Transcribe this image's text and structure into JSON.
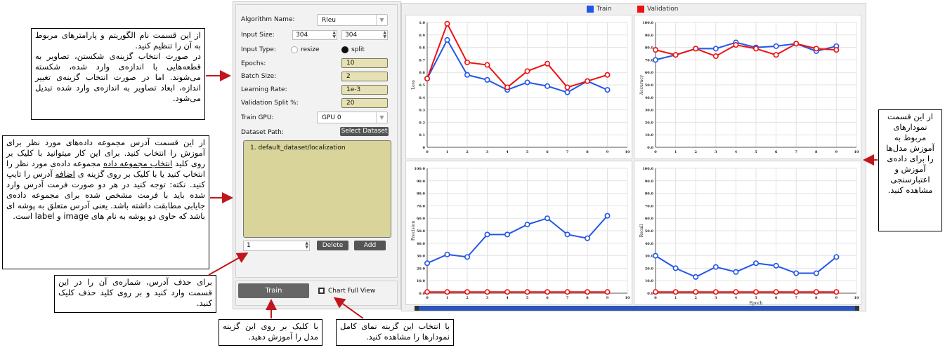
{
  "callouts": {
    "params": [
      "از این قسمت نام الگوریتم و پارامترهای مربوط به آن را تنظیم کنید.",
      "در صورت انتخاب گزینه‌ی شکستن، تصاویر به قطعه‌هایی با اندازه‌ی وارد شده، شکسته می‌شوند. اما در صورت انتخاب گزینه‌ی تغییر اندازه، ابعاد تصاویر به اندازه‌ی وارد شده تبدیل می‌شود."
    ],
    "dataset_a": "از این قسمت آدرس مجموعه داده‌های مورد نظر برای آموزش را انتخاب کنید. برای این کار میتوانید با کلیک بر روی کلید",
    "dataset_u1": "انتخاب مجموعه داده",
    "dataset_b": "مجموعه داده‌ی مورد نظر را انتخاب کنید یا با کلیک بر روی گزینه ی",
    "dataset_u2": "اضافه",
    "dataset_c": "آدرس را تایپ کنید. نکته: توجه کنید در هر دو صورت فرمت آدرس وارد شده باید با فرمت مشخص شده برای مجموعه داده‌ی جایابی مطابقت داشته باشد. یعنی آدرس متعلق به پوشه ای باشد که حاوی دو پوشه به نام های image و label است.",
    "delete": "برای حذف آدرس، شماره‌ی آن را در این قسمت وارد کنید و بر روی کلید حذف کلیک کنید.",
    "train": "با کلیک بر روی این گزینه مدل را آموزش دهید.",
    "fullview": "با انتخاب این گزینه نمای کامل نمودارها را مشاهده کنید.",
    "charts": "از این قسمت نمودارهای مربوط به آموزش مدل‌ها را برای داده‌ی آموزش و اعتبارسنجی مشاهده کنید."
  },
  "form": {
    "algorithm_label": "Algorithm Name:",
    "algorithm_value": "Rleu",
    "input_size_label": "Input Size:",
    "input_w": "304",
    "input_h": "304",
    "input_type_label": "Input Type:",
    "resize_label": "resize",
    "split_label": "split",
    "epochs_label": "Epochs:",
    "epochs_value": "10",
    "batch_label": "Batch Size:",
    "batch_value": "2",
    "lr_label": "Learning Rate:",
    "lr_value": "1e-3",
    "val_label": "Validation Split %:",
    "val_value": "20",
    "gpu_label": "Train GPU:",
    "gpu_value": "GPU 0",
    "dataset_label": "Dataset Path:",
    "select_dataset": "Select Dataset",
    "dataset_items": [
      "1. default_dataset/localization"
    ],
    "index_value": "1",
    "delete_label": "Delete",
    "add_label": "Add",
    "train_label": "Train",
    "fullview_label": "Chart Full View"
  },
  "legend": {
    "train": "Train",
    "validation": "Validation"
  },
  "colors": {
    "train": "#2255e8",
    "validation": "#ee1111"
  },
  "chart_data": [
    {
      "type": "line",
      "ylabel": "Loss",
      "xlabel": "",
      "x": [
        0,
        1,
        2,
        3,
        4,
        5,
        6,
        7,
        8,
        9
      ],
      "xlim": [
        0,
        10
      ],
      "ylim": [
        0,
        1.0
      ],
      "xticks": [
        "0",
        "1",
        "2",
        "3",
        "4",
        "5",
        "6",
        "7",
        "8",
        "9",
        "10"
      ],
      "yticks": [
        "0",
        "0.1",
        "0.2",
        "0.3",
        "0.4",
        "0.5",
        "0.6",
        "0.7",
        "0.8",
        "0.9",
        "1.0"
      ],
      "series": [
        {
          "name": "Train",
          "values": [
            0.55,
            0.86,
            0.58,
            0.54,
            0.46,
            0.52,
            0.49,
            0.44,
            0.53,
            0.46
          ]
        },
        {
          "name": "Validation",
          "values": [
            0.55,
            0.99,
            0.68,
            0.66,
            0.48,
            0.61,
            0.67,
            0.48,
            0.53,
            0.58
          ]
        }
      ]
    },
    {
      "type": "line",
      "ylabel": "Accuracy",
      "xlabel": "",
      "x": [
        0,
        1,
        2,
        3,
        4,
        5,
        6,
        7,
        8,
        9
      ],
      "xlim": [
        0,
        10
      ],
      "ylim": [
        0,
        100
      ],
      "xticks": [
        "0",
        "1",
        "2",
        "3",
        "4",
        "5",
        "6",
        "7",
        "8",
        "9",
        "10"
      ],
      "yticks": [
        "0.0",
        "10.0",
        "20.0",
        "30.0",
        "40.0",
        "50.0",
        "60.0",
        "70.0",
        "80.0",
        "90.0",
        "100.0"
      ],
      "series": [
        {
          "name": "Train",
          "values": [
            70,
            74,
            79,
            79,
            84,
            80,
            81,
            83,
            77,
            81
          ]
        },
        {
          "name": "Validation",
          "values": [
            78,
            74,
            79,
            73,
            82,
            79,
            74,
            83,
            79,
            78
          ]
        }
      ]
    },
    {
      "type": "line",
      "ylabel": "Precision",
      "xlabel": "",
      "x": [
        0,
        1,
        2,
        3,
        4,
        5,
        6,
        7,
        8,
        9
      ],
      "xlim": [
        0,
        10
      ],
      "ylim": [
        0,
        100
      ],
      "xticks": [
        "0",
        "1",
        "2",
        "3",
        "4",
        "5",
        "6",
        "7",
        "8",
        "9",
        "10"
      ],
      "yticks": [
        "0.0",
        "10.0",
        "20.0",
        "30.0",
        "40.0",
        "50.0",
        "60.0",
        "70.0",
        "80.0",
        "90.0",
        "100.0"
      ],
      "series": [
        {
          "name": "Train",
          "values": [
            24,
            31,
            29,
            47,
            47,
            55,
            60,
            47,
            44,
            62
          ]
        },
        {
          "name": "Validation",
          "values": [
            1,
            1,
            1,
            1,
            1,
            1,
            1,
            1,
            1,
            1
          ]
        }
      ]
    },
    {
      "type": "line",
      "ylabel": "Recall",
      "xlabel": "Epoch",
      "x": [
        0,
        1,
        2,
        3,
        4,
        5,
        6,
        7,
        8,
        9
      ],
      "xlim": [
        0,
        10
      ],
      "ylim": [
        0,
        100
      ],
      "xticks": [
        "0",
        "1",
        "2",
        "3",
        "4",
        "5",
        "6",
        "7",
        "8",
        "9",
        "10"
      ],
      "yticks": [
        "0.0",
        "10.0",
        "20.0",
        "30.0",
        "40.0",
        "50.0",
        "60.0",
        "70.0",
        "80.0",
        "90.0",
        "100.0"
      ],
      "series": [
        {
          "name": "Train",
          "values": [
            30,
            20,
            13,
            21,
            17,
            24,
            22,
            16,
            16,
            29
          ]
        },
        {
          "name": "Validation",
          "values": [
            1,
            1,
            1,
            1,
            1,
            1,
            1,
            1,
            1,
            1
          ]
        }
      ]
    }
  ]
}
